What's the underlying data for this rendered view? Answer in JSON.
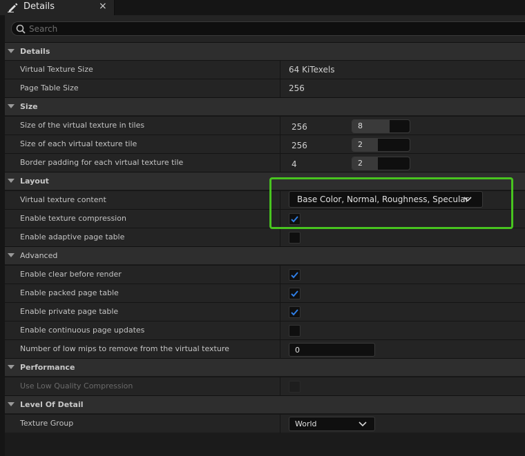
{
  "window": {
    "tab_title": "Details",
    "close_glyph": "×",
    "tab_icon": "pencil-icon"
  },
  "search": {
    "placeholder": "Search",
    "value": ""
  },
  "colors": {
    "accent_checkbox": "#2f7ee5",
    "highlight": "#48c41f"
  },
  "categories": {
    "details": {
      "title": "Details",
      "rows": {
        "vt_size": {
          "label": "Virtual Texture Size",
          "value": "64 KiTexels"
        },
        "pt_size": {
          "label": "Page Table Size",
          "value": "256"
        }
      }
    },
    "size": {
      "title": "Size",
      "rows": {
        "tiles": {
          "label": "Size of the virtual texture in tiles",
          "value": "256",
          "spin": "8",
          "spin_fraction": 0.65
        },
        "tile": {
          "label": "Size of each virtual texture tile",
          "value": "256",
          "spin": "2",
          "spin_fraction": 0.45
        },
        "border": {
          "label": "Border padding for each virtual texture tile",
          "value": "4",
          "spin": "2",
          "spin_fraction": 0.45
        }
      }
    },
    "layout": {
      "title": "Layout",
      "rows": {
        "content": {
          "label": "Virtual texture content",
          "value": "Base Color, Normal, Roughness, Specular"
        },
        "compression": {
          "label": "Enable texture compression",
          "checked": true
        },
        "adaptive": {
          "label": "Enable adaptive page table",
          "checked": false
        }
      }
    },
    "advanced": {
      "title": "Advanced",
      "rows": {
        "clear": {
          "label": "Enable clear before render",
          "checked": true
        },
        "packed": {
          "label": "Enable packed page table",
          "checked": true
        },
        "private": {
          "label": "Enable private page table",
          "checked": true
        },
        "continuous": {
          "label": "Enable continuous page updates",
          "checked": false
        },
        "lowmips": {
          "label": "Number of low mips to remove from the virtual texture",
          "value": "0"
        }
      }
    },
    "performance": {
      "title": "Performance",
      "rows": {
        "lowquality": {
          "label": "Use Low Quality Compression",
          "checked": false,
          "disabled": true
        }
      }
    },
    "lod": {
      "title": "Level Of Detail",
      "rows": {
        "group": {
          "label": "Texture Group",
          "value": "World"
        }
      }
    }
  }
}
